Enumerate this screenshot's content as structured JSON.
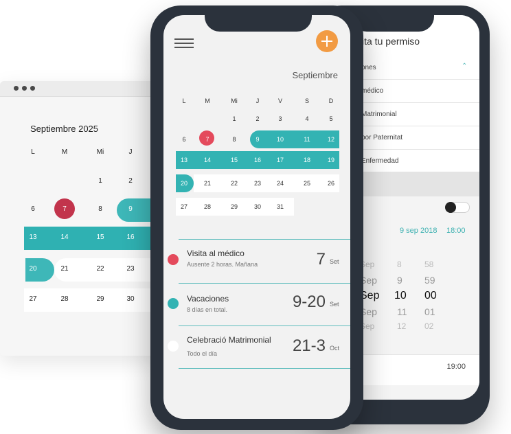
{
  "desktop": {
    "title": "Septiembre 2025",
    "weekdays": [
      "L",
      "M",
      "Mi",
      "J"
    ],
    "rows": [
      [
        "",
        "",
        "1",
        "2"
      ],
      [
        "6",
        "7",
        "8",
        "9"
      ],
      [
        "13",
        "14",
        "15",
        "16"
      ],
      [
        "20",
        "21",
        "22",
        "23"
      ],
      [
        "27",
        "28",
        "29",
        "30"
      ]
    ]
  },
  "back_phone": {
    "title": "cita tu permiso",
    "section": "ones",
    "items": [
      "médico",
      "Matrimonial",
      "por Paternitat",
      "Enfermedad"
    ],
    "date": "9 sep 2018",
    "time": "18:00",
    "picker": [
      [
        "Sep",
        "8",
        "58"
      ],
      [
        "Sep",
        "9",
        "59"
      ],
      [
        "Sep",
        "10",
        "00"
      ],
      [
        "Sep",
        "11",
        "01"
      ],
      [
        "Sep",
        "12",
        "02"
      ]
    ],
    "end_time": "19:00"
  },
  "phone": {
    "month": "Septiembre",
    "weekdays": [
      "L",
      "M",
      "Mi",
      "J",
      "V",
      "S",
      "D"
    ],
    "weeks": [
      [
        "",
        "",
        "1",
        "2",
        "3",
        "4",
        "5"
      ],
      [
        "6",
        "7",
        "8",
        "9",
        "10",
        "11",
        "12"
      ],
      [
        "13",
        "14",
        "15",
        "16",
        "17",
        "18",
        "19"
      ],
      [
        "20",
        "21",
        "22",
        "23",
        "24",
        "25",
        "26"
      ],
      [
        "27",
        "28",
        "29",
        "30",
        "31",
        "",
        ""
      ]
    ],
    "events": [
      {
        "title": "Visita al médico",
        "subtitle": "Ausente 2 horas. Mañana",
        "day": "7",
        "month": "Set",
        "color": "#e44a5c"
      },
      {
        "title": "Vacaciones",
        "subtitle": "8 días en total.",
        "day": "9-20",
        "month": "Set",
        "color": "#33b3b3"
      },
      {
        "title": "Celebració Matrimonial",
        "subtitle": "Todo el día",
        "day": "21-3",
        "month": "Oct",
        "color": "#ffffff"
      }
    ]
  }
}
